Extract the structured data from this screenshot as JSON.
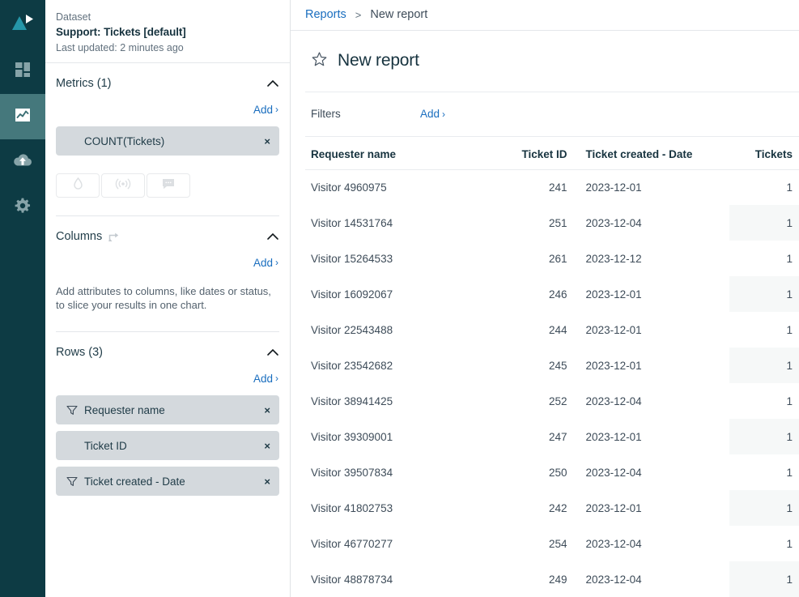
{
  "rail": {
    "logo": "logo-triangle-play",
    "items": [
      {
        "name": "dashboards-icon",
        "active": false
      },
      {
        "name": "reports-chart-icon",
        "active": true
      },
      {
        "name": "cloud-upload-icon",
        "active": false
      },
      {
        "name": "settings-gear-icon",
        "active": false
      }
    ]
  },
  "breadcrumb": {
    "parent": "Reports",
    "separator": ">",
    "current": "New report"
  },
  "dataset": {
    "label": "Dataset",
    "name": "Support: Tickets [default]",
    "updated": "Last updated: 2 minutes ago"
  },
  "metrics": {
    "title": "Metrics (1)",
    "add_label": "Add",
    "add_caret": "›",
    "collapse_icon": "chevron-up-icon",
    "chips": [
      {
        "label": "COUNT(Tickets)",
        "remove": "×",
        "has_filter": false
      }
    ],
    "tools": [
      {
        "name": "droplet-icon"
      },
      {
        "name": "signal-icon"
      },
      {
        "name": "comment-icon"
      }
    ]
  },
  "columns": {
    "title": "Columns",
    "reorder_icon": "move-arrow-icon",
    "add_label": "Add",
    "add_caret": "›",
    "collapse_icon": "chevron-up-icon",
    "hint": "Add attributes to columns, like dates or status, to slice your results in one chart."
  },
  "rows": {
    "title": "Rows (3)",
    "add_label": "Add",
    "add_caret": "›",
    "collapse_icon": "chevron-up-icon",
    "chips": [
      {
        "label": "Requester name",
        "remove": "×",
        "has_filter": true
      },
      {
        "label": "Ticket ID",
        "remove": "×",
        "has_filter": false
      },
      {
        "label": "Ticket created - Date",
        "remove": "×",
        "has_filter": true
      }
    ]
  },
  "report": {
    "favorite_icon": "star-outline-icon",
    "title": "New report"
  },
  "filters": {
    "label": "Filters",
    "add_label": "Add",
    "add_caret": "›"
  },
  "table": {
    "headers": [
      "Requester name",
      "Ticket ID",
      "Ticket created - Date",
      "Tickets"
    ],
    "rows": [
      [
        "Visitor 4960975",
        "241",
        "2023-12-01",
        "1"
      ],
      [
        "Visitor 14531764",
        "251",
        "2023-12-04",
        "1"
      ],
      [
        "Visitor 15264533",
        "261",
        "2023-12-12",
        "1"
      ],
      [
        "Visitor 16092067",
        "246",
        "2023-12-01",
        "1"
      ],
      [
        "Visitor 22543488",
        "244",
        "2023-12-01",
        "1"
      ],
      [
        "Visitor 23542682",
        "245",
        "2023-12-01",
        "1"
      ],
      [
        "Visitor 38941425",
        "252",
        "2023-12-04",
        "1"
      ],
      [
        "Visitor 39309001",
        "247",
        "2023-12-01",
        "1"
      ],
      [
        "Visitor 39507834",
        "250",
        "2023-12-04",
        "1"
      ],
      [
        "Visitor 41802753",
        "242",
        "2023-12-01",
        "1"
      ],
      [
        "Visitor 46770277",
        "254",
        "2023-12-04",
        "1"
      ],
      [
        "Visitor 48878734",
        "249",
        "2023-12-04",
        "1"
      ]
    ]
  },
  "colors": {
    "rail_bg": "#0d3b44",
    "rail_active": "#45787c",
    "logo_teal": "#2596a8",
    "link_blue": "#1a6ebf",
    "chip_bg": "#d4d9dd",
    "alt_cell": "#f6f8f8"
  }
}
